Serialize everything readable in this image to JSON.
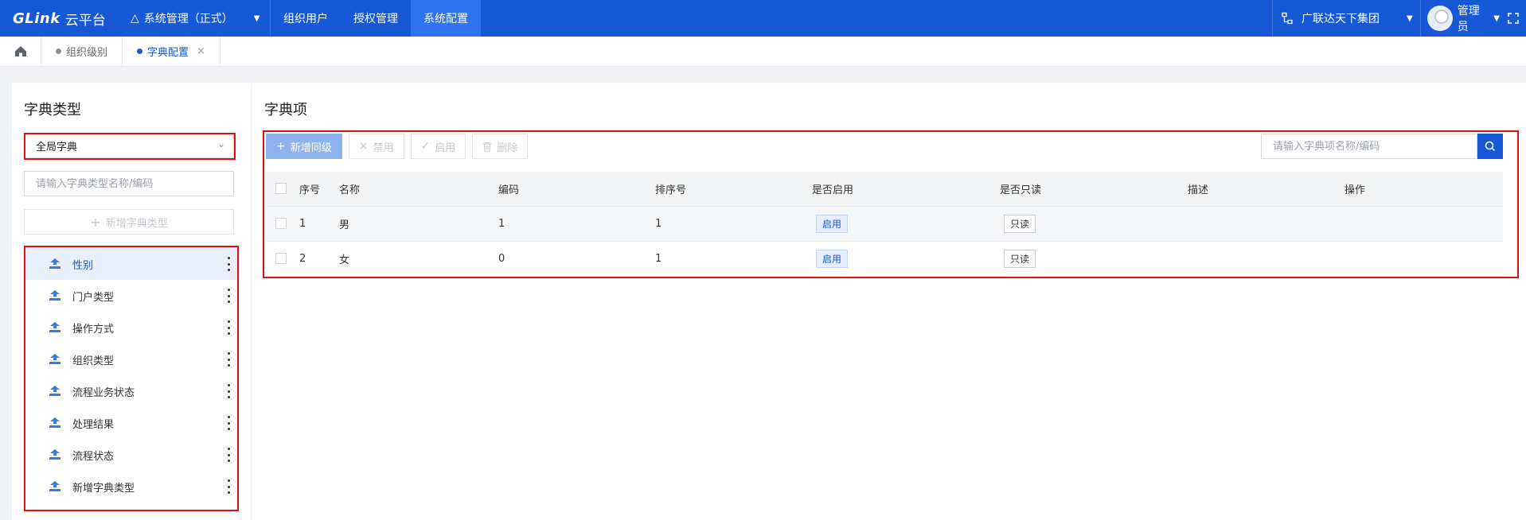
{
  "app": {
    "brand": "GLink",
    "name": "云平台"
  },
  "system_menu": {
    "label": "系统管理（正式）"
  },
  "nav": [
    {
      "label": "组织用户"
    },
    {
      "label": "授权管理"
    },
    {
      "label": "系统配置"
    }
  ],
  "org": {
    "label": "广联达天下集团"
  },
  "user": {
    "label": "管理员"
  },
  "tabs": [
    {
      "label": "组织级别"
    },
    {
      "label": "字典配置"
    }
  ],
  "left_panel": {
    "title": "字典类型",
    "select_value": "全局字典",
    "search_placeholder": "请输入字典类型名称/编码",
    "add_label": "新增字典类型",
    "items": [
      {
        "label": "性别"
      },
      {
        "label": "门户类型"
      },
      {
        "label": "操作方式"
      },
      {
        "label": "组织类型"
      },
      {
        "label": "流程业务状态"
      },
      {
        "label": "处理结果"
      },
      {
        "label": "流程状态"
      },
      {
        "label": "新增字典类型"
      }
    ]
  },
  "right_panel": {
    "title": "字典项",
    "buttons": {
      "add": "新增同级",
      "disable": "禁用",
      "enable": "启用",
      "delete": "删除"
    },
    "search_placeholder": "请输入字典项名称/编码",
    "columns": [
      "序号",
      "名称",
      "编码",
      "排序号",
      "是否启用",
      "是否只读",
      "描述",
      "操作"
    ],
    "rows": [
      {
        "index": "1",
        "name": "男",
        "code": "1",
        "sort": "1",
        "enabled": "启用",
        "readonly": "只读",
        "desc": "",
        "ops": ""
      },
      {
        "index": "2",
        "name": "女",
        "code": "0",
        "sort": "1",
        "enabled": "启用",
        "readonly": "只读",
        "desc": "",
        "ops": ""
      }
    ]
  },
  "colors": {
    "primary": "#1758d6",
    "nav_active": "#2f73f0",
    "highlight_frame": "#e01010"
  }
}
